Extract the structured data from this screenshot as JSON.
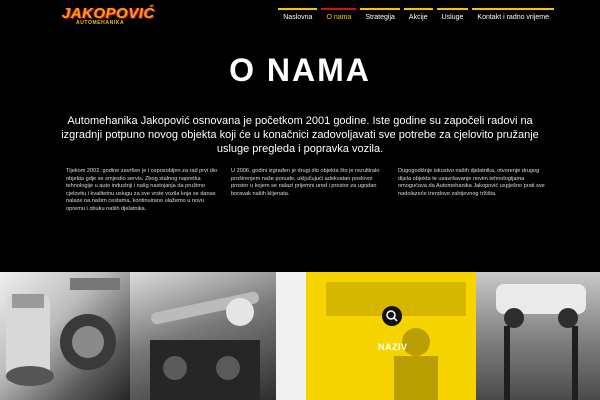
{
  "logo": {
    "name": "JAKOPOVIĆ",
    "sub": "AUTOMEHANIKA"
  },
  "nav": {
    "items": [
      {
        "label": "Naslovna"
      },
      {
        "label": "O nama"
      },
      {
        "label": "Strategija"
      },
      {
        "label": "Akcije"
      },
      {
        "label": "Usluge"
      },
      {
        "label": "Kontakt i radno vrijeme"
      }
    ],
    "active": "O nama"
  },
  "page": {
    "title": "O NAMA",
    "intro": "Automehanika Jakopović osnovana je početkom 2001 godine. Iste godine su započeli radovi na izgradnji potpuno novog objekta koji će u konačnici zadovoljavati sve potrebe za cjelovito pružanje usluge pregleda i popravka vozila.",
    "columns": [
      "Tijekom 2002. godine završen je i osposobljen za rad prvi dio objekta gdje se smjestio servis. Zbog stalnog napretka tehnologije u auto industriji i našg nastojanja da pružimo cjelovitu i kvalitetnu uslugu za sve vrste vozila koja se danas nalaze na našim cestama, kontinuirano ulažemo u novu opremu i obuku naših djelatnika.",
      "U 2006. godini izgrađen je drugi dio objekta što je rezultiralo proširenjem naše ponude, uključujući adekvatan poslovni prostor u kojem se nalazi prijemni ured i prostor za ugodan boravak naših klijenata.",
      "Dugogodišnje iskustvo naših djelatnika, otvorenje drugog dijela objekta te usavršavanje novim tehnologijama omogućava da Automehanika Jakopović uspješno prati sve nadolazeće trendove zahtjevnog tržišta."
    ]
  },
  "gallery": {
    "hover_label": "NAZIV",
    "overlay_color": "#f5d400"
  },
  "icons": {
    "search": "search-icon"
  },
  "colors": {
    "accent": "#f5c600",
    "active": "#d41212",
    "background": "#000000"
  }
}
